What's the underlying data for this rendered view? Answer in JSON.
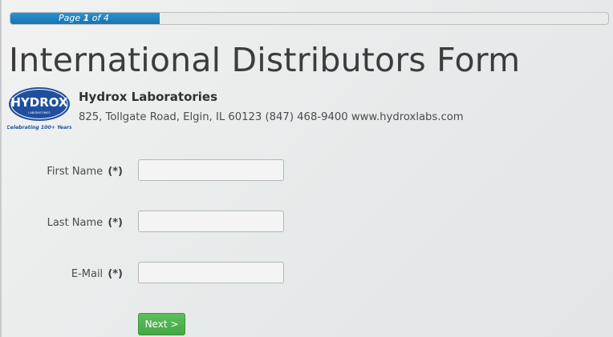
{
  "progress": {
    "label_prefix": "Page ",
    "current_page": "1",
    "label_suffix": " of 4",
    "fraction": 0.25
  },
  "form": {
    "title": "International Distributors Form"
  },
  "company": {
    "logo_text": "HYDROX",
    "logo_subtext": "LABORATORIES",
    "logo_tagline": "Celebrating 100+ Years",
    "name": "Hydrox Laboratories",
    "info": "825, Tollgate Road, Elgin, IL 60123  (847) 468-9400 www.hydroxlabs.com"
  },
  "fields": {
    "first_name": {
      "label": "First Name",
      "required_mark": "(*)",
      "value": ""
    },
    "last_name": {
      "label": "Last Name",
      "required_mark": "(*)",
      "value": ""
    },
    "email": {
      "label": "E-Mail",
      "required_mark": "(*)",
      "value": ""
    }
  },
  "buttons": {
    "next_label": "Next >"
  },
  "colors": {
    "progress_fill": "#1f7fc0",
    "next_button": "#4cae4c",
    "logo_blue": "#1f4f9e"
  }
}
